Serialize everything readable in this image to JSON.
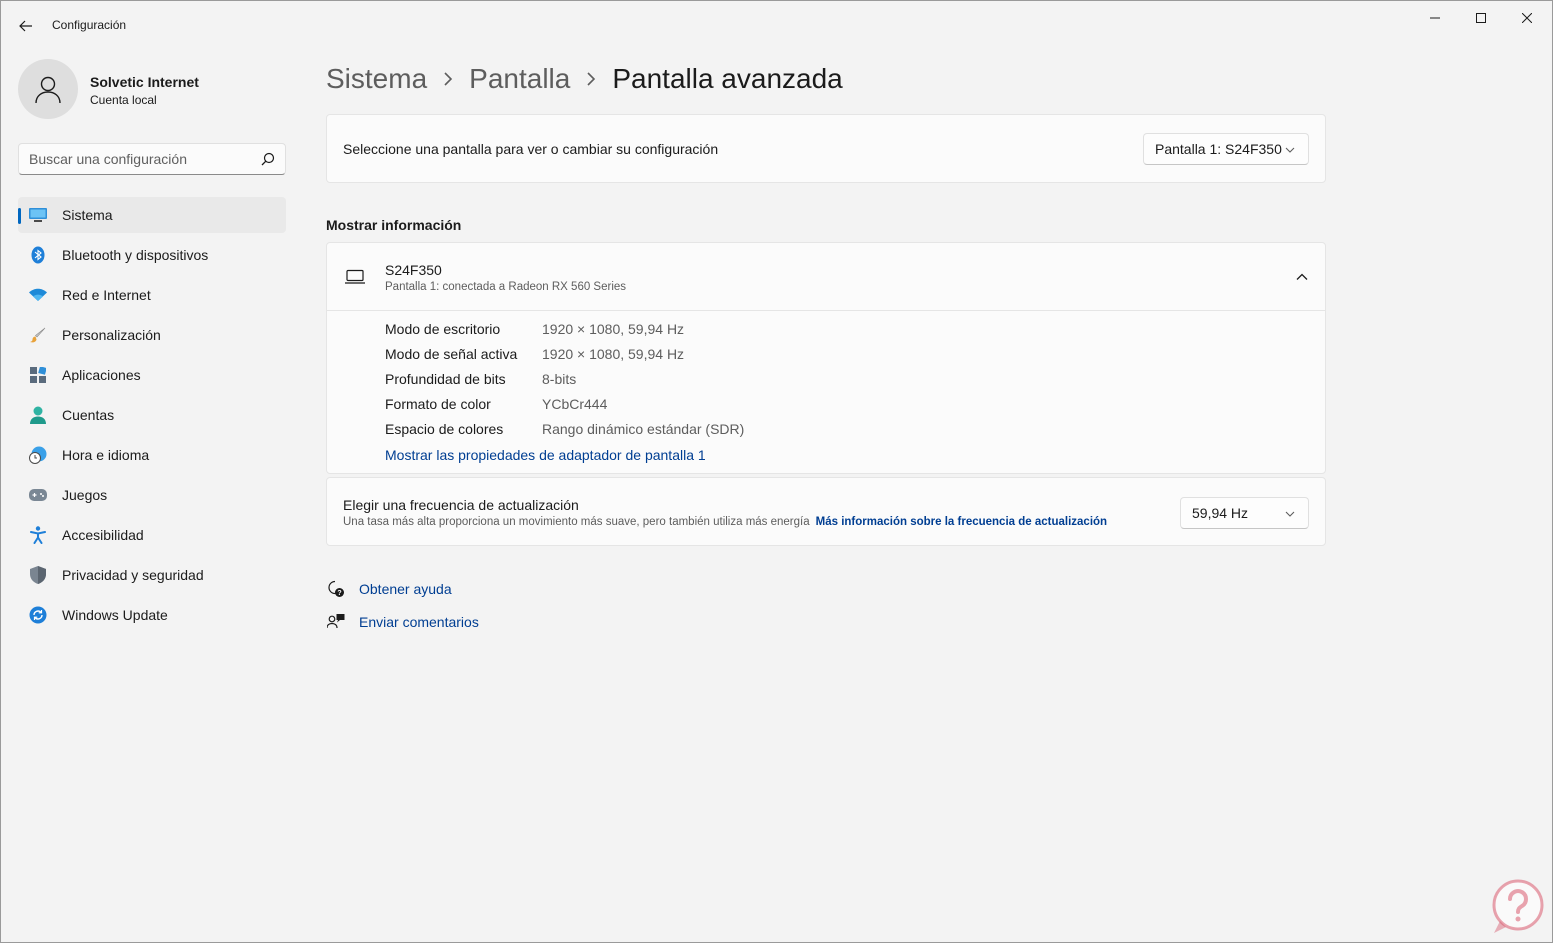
{
  "window": {
    "title": "Configuración"
  },
  "profile": {
    "name": "Solvetic Internet",
    "account_type": "Cuenta local"
  },
  "search": {
    "placeholder": "Buscar una configuración"
  },
  "sidebar": {
    "items": [
      {
        "label": "Sistema",
        "icon": "system-icon",
        "active": true
      },
      {
        "label": "Bluetooth y dispositivos",
        "icon": "bluetooth-icon"
      },
      {
        "label": "Red e Internet",
        "icon": "wifi-icon"
      },
      {
        "label": "Personalización",
        "icon": "brush-icon"
      },
      {
        "label": "Aplicaciones",
        "icon": "apps-icon"
      },
      {
        "label": "Cuentas",
        "icon": "account-icon"
      },
      {
        "label": "Hora e idioma",
        "icon": "clock-globe-icon"
      },
      {
        "label": "Juegos",
        "icon": "gamepad-icon"
      },
      {
        "label": "Accesibilidad",
        "icon": "accessibility-icon"
      },
      {
        "label": "Privacidad y seguridad",
        "icon": "shield-icon"
      },
      {
        "label": "Windows Update",
        "icon": "update-icon"
      }
    ]
  },
  "breadcrumb": {
    "items": [
      "Sistema",
      "Pantalla",
      "Pantalla avanzada"
    ]
  },
  "display_select": {
    "label": "Seleccione una pantalla para ver o cambiar su configuración",
    "value": "Pantalla 1: S24F350"
  },
  "display_info": {
    "section_title": "Mostrar información",
    "name": "S24F350",
    "subtitle": "Pantalla 1: conectada a Radeon RX 560 Series",
    "rows": [
      {
        "key": "Modo de escritorio",
        "value": "1920 × 1080, 59,94 Hz"
      },
      {
        "key": "Modo de señal activa",
        "value": "1920 × 1080, 59,94 Hz"
      },
      {
        "key": "Profundidad de bits",
        "value": "8-bits"
      },
      {
        "key": "Formato de color",
        "value": "YCbCr444"
      },
      {
        "key": "Espacio de colores",
        "value": "Rango dinámico estándar (SDR)"
      }
    ],
    "adapter_link": "Mostrar las propiedades de adaptador de pantalla 1"
  },
  "refresh": {
    "title": "Elegir una frecuencia de actualización",
    "description": "Una tasa más alta proporciona un movimiento más suave, pero también utiliza más energía",
    "link": "Más información sobre la frecuencia de actualización",
    "value": "59,94 Hz"
  },
  "help": {
    "get_help": "Obtener ayuda",
    "feedback": "Enviar comentarios"
  },
  "colors": {
    "accent": "#0067c0",
    "link": "#003e92"
  }
}
